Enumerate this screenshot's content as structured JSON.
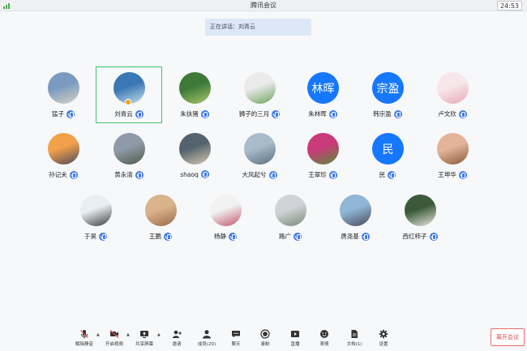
{
  "window": {
    "title": "腾讯会议",
    "clock": "24:53"
  },
  "speaking": {
    "label": "正在讲话：刘青云"
  },
  "participants": [
    {
      "name": "猛子",
      "avatar_text": "",
      "colors": [
        "#7a9bbf",
        "#d9d2c6"
      ]
    },
    {
      "name": "刘青云",
      "avatar_text": "",
      "colors": [
        "#3a77b5",
        "#c9dfe9"
      ],
      "selected": true
    },
    {
      "name": "朱扶猪",
      "avatar_text": "",
      "colors": [
        "#3d7a3a",
        "#a8c86a"
      ]
    },
    {
      "name": "狮子的三月",
      "avatar_text": "",
      "colors": [
        "#eaeaea",
        "#6aa35a"
      ]
    },
    {
      "name": "朱林晖",
      "avatar_text": "林晖",
      "colors": [
        "#1677ff",
        "#1677ff"
      ]
    },
    {
      "name": "韩宗盈",
      "avatar_text": "宗盈",
      "colors": [
        "#1677ff",
        "#1677ff"
      ]
    },
    {
      "name": "卢文欣",
      "avatar_text": "",
      "colors": [
        "#f7e7ea",
        "#e8a9b8"
      ]
    },
    {
      "name": "孙记夫",
      "avatar_text": "",
      "colors": [
        "#f2a04a",
        "#4d4a5a"
      ]
    },
    {
      "name": "黄永清",
      "avatar_text": "",
      "colors": [
        "#8e9aa7",
        "#4f5b4a"
      ]
    },
    {
      "name": "shaoq",
      "avatar_text": "",
      "colors": [
        "#54636e",
        "#d8c9b0"
      ]
    },
    {
      "name": "大风起兮",
      "avatar_text": "",
      "colors": [
        "#a9bbc9",
        "#5a6f80"
      ]
    },
    {
      "name": "王翠珍",
      "avatar_text": "",
      "colors": [
        "#c93a7a",
        "#5e8c3a"
      ]
    },
    {
      "name": "民",
      "avatar_text": "民",
      "colors": [
        "#1677ff",
        "#1677ff"
      ]
    },
    {
      "name": "王坤华",
      "avatar_text": "",
      "colors": [
        "#e3b49a",
        "#8a5a3a"
      ]
    },
    {
      "name": "于昊",
      "avatar_text": "",
      "colors": [
        "#e9eef2",
        "#3b3b3b"
      ]
    },
    {
      "name": "王鹏",
      "avatar_text": "",
      "colors": [
        "#d9b48a",
        "#9a6a4a"
      ]
    },
    {
      "name": "杨静",
      "avatar_text": "",
      "colors": [
        "#f2f2f2",
        "#c2566a"
      ]
    },
    {
      "name": "路广",
      "avatar_text": "",
      "colors": [
        "#d0d4d8",
        "#7a8a78"
      ]
    },
    {
      "name": "唐尧基",
      "avatar_text": "",
      "colors": [
        "#8fb6d6",
        "#4a4a5a"
      ]
    },
    {
      "name": "西红柿子",
      "avatar_text": "",
      "colors": [
        "#3c5a3a",
        "#e8e8e0"
      ]
    }
  ],
  "toolbar": {
    "items": [
      {
        "label": "解除静音",
        "icon": "mic-muted-icon"
      },
      {
        "label": "开启视频",
        "icon": "video-off-icon"
      },
      {
        "label": "共享屏幕",
        "icon": "share-screen-icon"
      },
      {
        "label": "邀请",
        "icon": "invite-icon"
      },
      {
        "label": "成员(20)",
        "icon": "members-icon"
      },
      {
        "label": "聊天",
        "icon": "chat-icon"
      },
      {
        "label": "录制",
        "icon": "record-icon"
      },
      {
        "label": "直播",
        "icon": "live-icon"
      },
      {
        "label": "表情",
        "icon": "emoji-icon"
      },
      {
        "label": "文档(1)",
        "icon": "document-icon"
      },
      {
        "label": "设置",
        "icon": "settings-icon"
      }
    ],
    "end_label": "离开会议"
  },
  "colors": {
    "accent": "#1677ff",
    "selected_border": "#3cc46a",
    "mic": "#3f7be6",
    "end": "#e04848"
  }
}
